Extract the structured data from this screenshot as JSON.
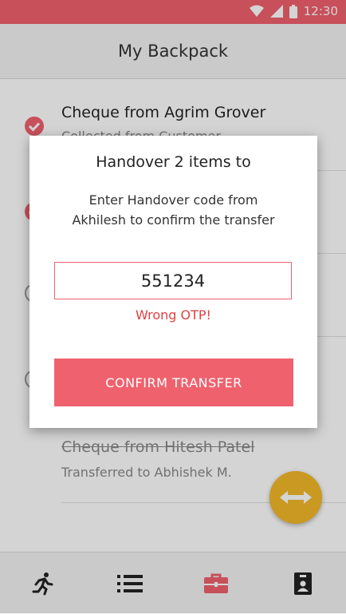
{
  "status_bar": {
    "time": "12:30"
  },
  "app_bar": {
    "title": "My Backpack"
  },
  "items": [
    {
      "title": "Cheque from Agrim Grover",
      "subtitle": "Collected from Customer",
      "checked": true
    },
    {
      "title": "",
      "subtitle": "",
      "checked": true
    },
    {
      "title": "",
      "subtitle": "",
      "checked": false
    },
    {
      "title": "",
      "subtitle": "",
      "checked": false
    },
    {
      "title": "Cheque from Hitesh Patel",
      "subtitle": "Transferred to Abhishek M.",
      "checked": false
    }
  ],
  "dialog": {
    "title": "Handover 2 items to",
    "message_line1": "Enter Handover code from",
    "message_line2": "Akhilesh to confirm the transfer",
    "code_value": "551234",
    "error": "Wrong OTP!",
    "confirm_label": "CONFIRM TRANSFER"
  },
  "fab": {
    "icon": "swap-horizontal-icon"
  },
  "bottom_nav": [
    {
      "icon": "running-icon",
      "active": false
    },
    {
      "icon": "list-icon",
      "active": false
    },
    {
      "icon": "briefcase-icon",
      "active": true
    },
    {
      "icon": "badge-icon",
      "active": false
    }
  ],
  "colors": {
    "accent": "#f0616e",
    "fab": "#f2b82a",
    "error": "#e04142"
  }
}
